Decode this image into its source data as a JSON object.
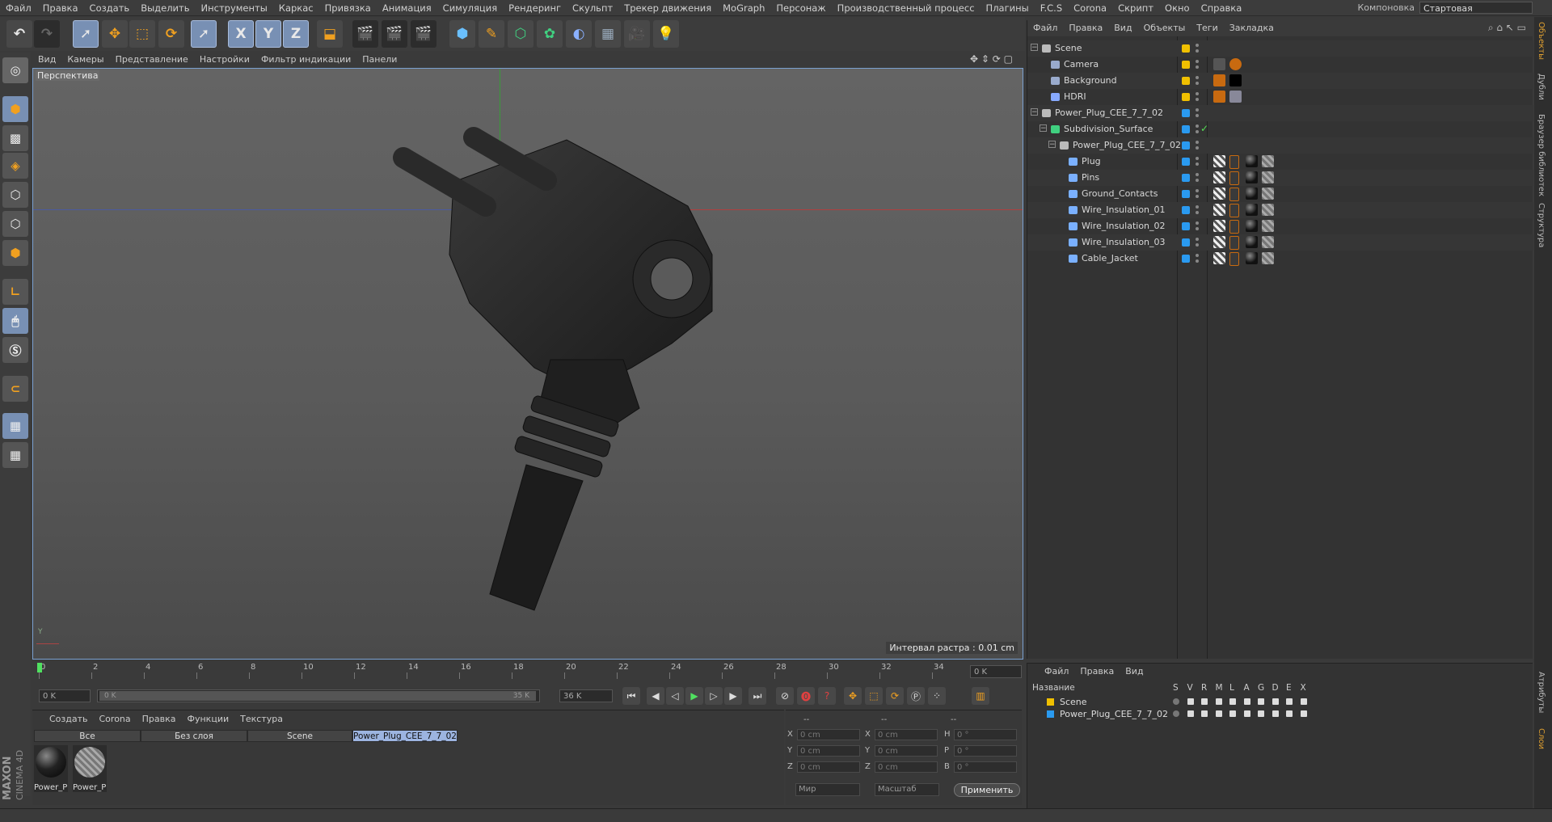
{
  "menubar": {
    "items": [
      "Файл",
      "Правка",
      "Создать",
      "Выделить",
      "Инструменты",
      "Каркас",
      "Привязка",
      "Анимация",
      "Симуляция",
      "Рендеринг",
      "Скульпт",
      "Трекер движения",
      "MoGraph",
      "Персонаж",
      "Производственный процесс",
      "Плагины",
      "F.C.S",
      "Corona",
      "Скрипт",
      "Окно",
      "Справка"
    ],
    "layout_label": "Компоновка",
    "layout_value": "Стартовая"
  },
  "axis_buttons": [
    "X",
    "Y",
    "Z"
  ],
  "viewport": {
    "menu": [
      "Вид",
      "Камеры",
      "Представление",
      "Настройки",
      "Фильтр индикации",
      "Панели"
    ],
    "camera_label": "Перспектива",
    "raster_interval": "Интервал растра : 0.01 cm"
  },
  "timeline": {
    "ticks": [
      "0",
      "2",
      "4",
      "6",
      "8",
      "10",
      "12",
      "14",
      "16",
      "18",
      "20",
      "22",
      "24",
      "26",
      "28",
      "30",
      "32",
      "34"
    ],
    "current_frame": "0 K",
    "start_field": "0 K",
    "range_start": "0 K",
    "range_end": "35 K",
    "end_field": "36 K"
  },
  "material_manager": {
    "menu": [
      "Создать",
      "Corona",
      "Правка",
      "Функции",
      "Текстура"
    ],
    "tabs": [
      "Все",
      "Без слоя",
      "Scene",
      "Power_Plug_CEE_7_7_02"
    ],
    "materials": [
      {
        "label": "Power_P",
        "kind": "sphere"
      },
      {
        "label": "Power_P",
        "kind": "hatched"
      }
    ]
  },
  "coordinates": {
    "header": [
      "--",
      "--",
      "--"
    ],
    "rows": [
      {
        "a": "X",
        "av": "0 cm",
        "b": "X",
        "bv": "0 cm",
        "c": "H",
        "cv": "0 °"
      },
      {
        "a": "Y",
        "av": "0 cm",
        "b": "Y",
        "bv": "0 cm",
        "c": "P",
        "cv": "0 °"
      },
      {
        "a": "Z",
        "av": "0 cm",
        "b": "Z",
        "bv": "0 cm",
        "c": "B",
        "cv": "0 °"
      }
    ],
    "mode1": "Мир",
    "mode2": "Масштаб",
    "apply": "Применить"
  },
  "object_manager": {
    "menu": [
      "Файл",
      "Правка",
      "Вид",
      "Объекты",
      "Теги",
      "Закладка"
    ],
    "objects": [
      {
        "name": "Scene",
        "depth": 0,
        "icon": "null-icon",
        "layer": "#f0c000",
        "tags": []
      },
      {
        "name": "Camera",
        "depth": 1,
        "icon": "camera-icon",
        "layer": "#f0c000",
        "tags": [
          "camera-tag",
          "restrict-tag"
        ]
      },
      {
        "name": "Background",
        "depth": 1,
        "icon": "background-icon",
        "layer": "#f0c000",
        "tags": [
          "render-tag",
          "black-tag"
        ]
      },
      {
        "name": "HDRI",
        "depth": 1,
        "icon": "sky-icon",
        "layer": "#f0c000",
        "tags": [
          "render-tag",
          "hdri-tag"
        ]
      },
      {
        "name": "Power_Plug_CEE_7_7_02",
        "depth": 0,
        "icon": "null-icon",
        "layer": "#2a9af0",
        "tags": []
      },
      {
        "name": "Subdivision_Surface",
        "depth": 1,
        "icon": "subdivision-icon",
        "layer": "#2a9af0",
        "tags": []
      },
      {
        "name": "Power_Plug_CEE_7_7_02",
        "depth": 2,
        "icon": "null-icon",
        "layer": "#2a9af0",
        "tags": []
      },
      {
        "name": "Plug",
        "depth": 3,
        "icon": "polygon-icon",
        "layer": "#2a9af0",
        "tags": [
          "phong",
          "sel",
          "mat",
          "hatch"
        ]
      },
      {
        "name": "Pins",
        "depth": 3,
        "icon": "polygon-icon",
        "layer": "#2a9af0",
        "tags": [
          "phong",
          "sel",
          "mat",
          "hatch"
        ]
      },
      {
        "name": "Ground_Contacts",
        "depth": 3,
        "icon": "polygon-icon",
        "layer": "#2a9af0",
        "tags": [
          "phong",
          "sel",
          "mat",
          "hatch"
        ]
      },
      {
        "name": "Wire_Insulation_01",
        "depth": 3,
        "icon": "polygon-icon",
        "layer": "#2a9af0",
        "tags": [
          "phong",
          "sel",
          "mat",
          "hatch"
        ]
      },
      {
        "name": "Wire_Insulation_02",
        "depth": 3,
        "icon": "polygon-icon",
        "layer": "#2a9af0",
        "tags": [
          "phong",
          "sel",
          "mat",
          "hatch"
        ]
      },
      {
        "name": "Wire_Insulation_03",
        "depth": 3,
        "icon": "polygon-icon",
        "layer": "#2a9af0",
        "tags": [
          "phong",
          "sel",
          "mat",
          "hatch"
        ]
      },
      {
        "name": "Cable_Jacket",
        "depth": 3,
        "icon": "polygon-icon",
        "layer": "#2a9af0",
        "tags": [
          "phong",
          "sel",
          "mat",
          "hatch"
        ]
      }
    ]
  },
  "layer_manager": {
    "menu": [
      "Файл",
      "Правка",
      "Вид"
    ],
    "header_name": "Название",
    "columns": [
      "S",
      "V",
      "R",
      "M",
      "L",
      "A",
      "G",
      "D",
      "E",
      "X"
    ],
    "layers": [
      {
        "name": "Scene",
        "color": "#f0c000"
      },
      {
        "name": "Power_Plug_CEE_7_7_02",
        "color": "#2a9af0"
      }
    ]
  },
  "side_tabs": [
    "Объекты",
    "Дубли",
    "Браузер библиотек",
    "Структура",
    "Атрибуты",
    "Слои"
  ],
  "brand": {
    "line1": "MAXON",
    "line2": "CINEMA 4D"
  }
}
